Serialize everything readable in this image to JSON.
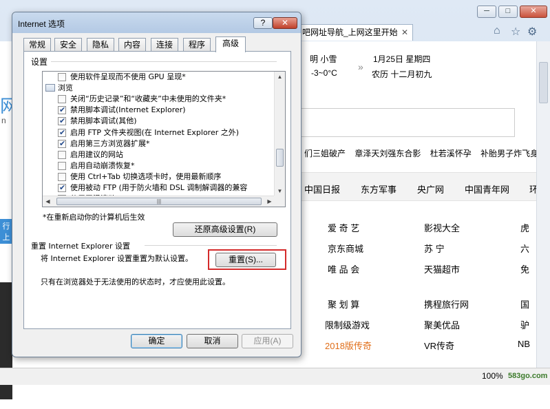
{
  "browser": {
    "tab_title": "吧网址导航_上网这里开始",
    "tab_close": "✕",
    "window_buttons": [
      "─",
      "□",
      "✕"
    ],
    "tool_icons": [
      "home-icon",
      "star-icon",
      "gear-icon"
    ],
    "weather": {
      "condition": "明  小雪",
      "temp": "-3~0°C",
      "date": "1月25日 星期四",
      "lunar": "农历 十二月初九",
      "arrow": "»"
    },
    "news": [
      "们三姐破产",
      "章泽天刘强东合影",
      "杜若溪怀孕",
      "补胎男子炸飞身亡"
    ],
    "nav": [
      "中国日报",
      "东方军事",
      "央广网",
      "中国青年网",
      "环"
    ],
    "sites": {
      "col1": [
        "爱 奇 艺",
        "京东商城",
        "唯 品 会",
        "聚 划 算",
        "限制级游戏",
        "2018版传奇"
      ],
      "col2": [
        "影视大全",
        "苏 宁",
        "天猫超市",
        "携程旅行网",
        "聚美优品",
        "VR传奇"
      ],
      "col3": [
        "虎",
        "六",
        "免",
        "国",
        "驴",
        "NB"
      ]
    },
    "left_glyphs": [
      "网",
      "n",
      "行",
      "上"
    ],
    "zoom": "100%",
    "watermark": "583go.com"
  },
  "dialog": {
    "title": "Internet 选项",
    "help_label": "?",
    "close_label": "✕",
    "tabs": [
      "常规",
      "安全",
      "隐私",
      "内容",
      "连接",
      "程序",
      "高级"
    ],
    "settings_group": "设置",
    "tree": [
      {
        "type": "check",
        "checked": false,
        "text": "使用软件呈现而不使用 GPU 呈现*"
      },
      {
        "type": "category",
        "text": "浏览"
      },
      {
        "type": "check",
        "checked": false,
        "text": "关闭“历史记录”和“收藏夹”中未使用的文件夹*"
      },
      {
        "type": "check",
        "checked": true,
        "text": "禁用脚本调试(Internet Explorer)"
      },
      {
        "type": "check",
        "checked": true,
        "text": "禁用脚本调试(其他)"
      },
      {
        "type": "check",
        "checked": true,
        "text": "启用 FTP 文件夹视图(在 Internet Explorer 之外)"
      },
      {
        "type": "check",
        "checked": true,
        "text": "启用第三方浏览器扩展*"
      },
      {
        "type": "check",
        "checked": false,
        "text": "启用建议的网站"
      },
      {
        "type": "check",
        "checked": false,
        "text": "启用自动崩溃恢复*"
      },
      {
        "type": "check",
        "checked": false,
        "text": "使用 Ctrl+Tab 切换选项卡时，使用最新顺序"
      },
      {
        "type": "check",
        "checked": true,
        "text": "使用被动 FTP (用于防火墙和 DSL 调制解调器的兼容"
      },
      {
        "type": "check",
        "checked": true,
        "text": "使用平滑滚动"
      }
    ],
    "restart_note": "*在重新启动你的计算机后生效",
    "restore_button": "还原高级设置(R)",
    "reset_group": "重置 Internet Explorer 设置",
    "reset_desc": "将 Internet Explorer 设置重置为默认设置。",
    "reset_button": "重置(S)...",
    "reset_note": "只有在浏览器处于无法使用的状态时，才应使用此设置。",
    "ok_button": "确定",
    "cancel_button": "取消",
    "apply_button": "应用(A)"
  }
}
